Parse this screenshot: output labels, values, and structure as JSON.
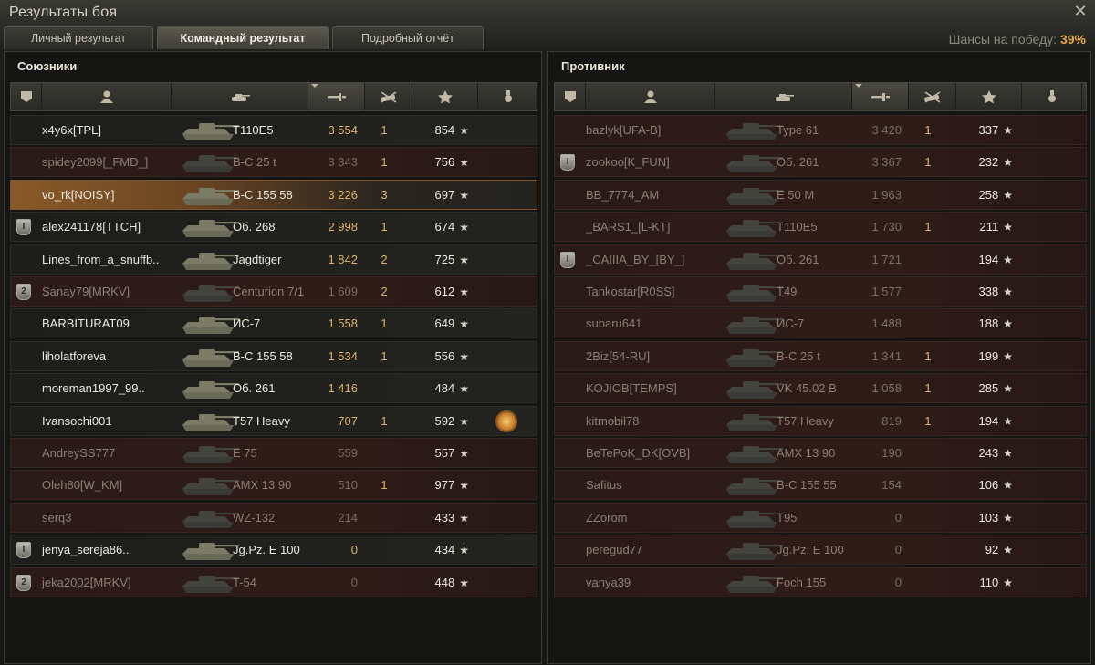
{
  "window": {
    "title": "Результаты боя"
  },
  "tabs": [
    {
      "label": "Личный результат",
      "active": false
    },
    {
      "label": "Командный результат",
      "active": true
    },
    {
      "label": "Подробный отчёт",
      "active": false
    }
  ],
  "win_chance": {
    "label": "Шансы на победу:",
    "value": "39%"
  },
  "colors": {
    "accent": "#e8a84a",
    "dead_row": "#2f1c19",
    "self_row": "#8a5a28"
  },
  "allies": {
    "title": "Союзники",
    "sorted_column": "damage",
    "players": [
      {
        "name": "x4y6x[TPL]",
        "tank": "T110E5",
        "damage": "3 554",
        "kills": "1",
        "xp": "854",
        "badge": "",
        "alive": true,
        "self": false,
        "medal": false
      },
      {
        "name": "spidey2099[_FMD_]",
        "tank": "В-С 25 t",
        "damage": "3 343",
        "kills": "1",
        "xp": "756",
        "badge": "",
        "alive": false,
        "self": false,
        "medal": false
      },
      {
        "name": "vo_rk[NOISY]",
        "tank": "В-С 155 58",
        "damage": "3 226",
        "kills": "3",
        "xp": "697",
        "badge": "",
        "alive": true,
        "self": true,
        "medal": false
      },
      {
        "name": "alex241178[TTCH]",
        "tank": "Об. 268",
        "damage": "2 998",
        "kills": "1",
        "xp": "674",
        "badge": "I",
        "alive": true,
        "self": false,
        "medal": false
      },
      {
        "name": "Lines_from_a_snuffb..",
        "tank": "Jagdtiger",
        "damage": "1 842",
        "kills": "2",
        "xp": "725",
        "badge": "",
        "alive": true,
        "self": false,
        "medal": false
      },
      {
        "name": "Sanay79[MRKV]",
        "tank": "Centurion 7/1",
        "damage": "1 609",
        "kills": "2",
        "xp": "612",
        "badge": "2",
        "alive": false,
        "self": false,
        "medal": false
      },
      {
        "name": "BARBITURAT09",
        "tank": "ИС-7",
        "damage": "1 558",
        "kills": "1",
        "xp": "649",
        "badge": "",
        "alive": true,
        "self": false,
        "medal": false
      },
      {
        "name": "liholatforeva",
        "tank": "В-С 155 58",
        "damage": "1 534",
        "kills": "1",
        "xp": "556",
        "badge": "",
        "alive": true,
        "self": false,
        "medal": false
      },
      {
        "name": "moreman1997_99..",
        "tank": "Об. 261",
        "damage": "1 416",
        "kills": "",
        "xp": "484",
        "badge": "",
        "alive": true,
        "self": false,
        "medal": false
      },
      {
        "name": "Ivansochi001",
        "tank": "T57 Heavy",
        "damage": "707",
        "kills": "1",
        "xp": "592",
        "badge": "",
        "alive": true,
        "self": false,
        "medal": true
      },
      {
        "name": "AndreySS777",
        "tank": "E 75",
        "damage": "559",
        "kills": "",
        "xp": "557",
        "badge": "",
        "alive": false,
        "self": false,
        "medal": false
      },
      {
        "name": "Oleh80[W_KM]",
        "tank": "AMX 13 90",
        "damage": "510",
        "kills": "1",
        "xp": "977",
        "badge": "",
        "alive": false,
        "self": false,
        "medal": false
      },
      {
        "name": "serq3",
        "tank": "WZ-132",
        "damage": "214",
        "kills": "",
        "xp": "433",
        "badge": "",
        "alive": false,
        "self": false,
        "medal": false
      },
      {
        "name": "jenya_sereja86..",
        "tank": "Jg.Pz. E 100",
        "damage": "0",
        "kills": "",
        "xp": "434",
        "badge": "I",
        "alive": true,
        "self": false,
        "medal": false
      },
      {
        "name": "jeka2002[MRKV]",
        "tank": "T-54",
        "damage": "0",
        "kills": "",
        "xp": "448",
        "badge": "2",
        "alive": false,
        "self": false,
        "medal": false
      }
    ]
  },
  "enemies": {
    "title": "Противник",
    "sorted_column": "damage",
    "players": [
      {
        "name": "bazlyk[UFA-B]",
        "tank": "Type 61",
        "damage": "3 420",
        "kills": "1",
        "xp": "337",
        "badge": "",
        "alive": false
      },
      {
        "name": "zookoo[K_FUN]",
        "tank": "Об. 261",
        "damage": "3 367",
        "kills": "1",
        "xp": "232",
        "badge": "I",
        "alive": false
      },
      {
        "name": "BB_7774_AM",
        "tank": "E 50 M",
        "damage": "1 963",
        "kills": "",
        "xp": "258",
        "badge": "",
        "alive": false
      },
      {
        "name": "_BARS1_[L-KT]",
        "tank": "T110E5",
        "damage": "1 730",
        "kills": "1",
        "xp": "211",
        "badge": "",
        "alive": false
      },
      {
        "name": "_CAIIIA_BY_[BY_]",
        "tank": "Об. 261",
        "damage": "1 721",
        "kills": "",
        "xp": "194",
        "badge": "I",
        "alive": false
      },
      {
        "name": "Tankostar[R0SS]",
        "tank": "T49",
        "damage": "1 577",
        "kills": "",
        "xp": "338",
        "badge": "",
        "alive": false
      },
      {
        "name": "subaru641",
        "tank": "ИС-7",
        "damage": "1 488",
        "kills": "",
        "xp": "188",
        "badge": "",
        "alive": false
      },
      {
        "name": "2Biz[54-RU]",
        "tank": "В-С 25 t",
        "damage": "1 341",
        "kills": "1",
        "xp": "199",
        "badge": "",
        "alive": false
      },
      {
        "name": "KOJIOB[TEMPS]",
        "tank": "VK 45.02 B",
        "damage": "1 058",
        "kills": "1",
        "xp": "285",
        "badge": "",
        "alive": false
      },
      {
        "name": "kitmobil78",
        "tank": "T57 Heavy",
        "damage": "819",
        "kills": "1",
        "xp": "194",
        "badge": "",
        "alive": false
      },
      {
        "name": "BeTePoK_DK[OVB]",
        "tank": "AMX 13 90",
        "damage": "190",
        "kills": "",
        "xp": "243",
        "badge": "",
        "alive": false
      },
      {
        "name": "Safitus",
        "tank": "В-С 155 55",
        "damage": "154",
        "kills": "",
        "xp": "106",
        "badge": "",
        "alive": false
      },
      {
        "name": "ZZorom",
        "tank": "T95",
        "damage": "0",
        "kills": "",
        "xp": "103",
        "badge": "",
        "alive": false
      },
      {
        "name": "peregud77",
        "tank": "Jg.Pz. E 100",
        "damage": "0",
        "kills": "",
        "xp": "92",
        "badge": "",
        "alive": false
      },
      {
        "name": "vanya39",
        "tank": "Foch 155",
        "damage": "0",
        "kills": "",
        "xp": "110",
        "badge": "",
        "alive": false
      }
    ]
  },
  "columns": [
    {
      "id": "badge",
      "icon": "shield-icon"
    },
    {
      "id": "player",
      "icon": "player-icon"
    },
    {
      "id": "tank",
      "icon": "tank-icon"
    },
    {
      "id": "damage",
      "icon": "damage-icon"
    },
    {
      "id": "kills",
      "icon": "destroyed-tank-icon"
    },
    {
      "id": "xp",
      "icon": "star-icon"
    },
    {
      "id": "medal",
      "icon": "medal-icon"
    }
  ]
}
